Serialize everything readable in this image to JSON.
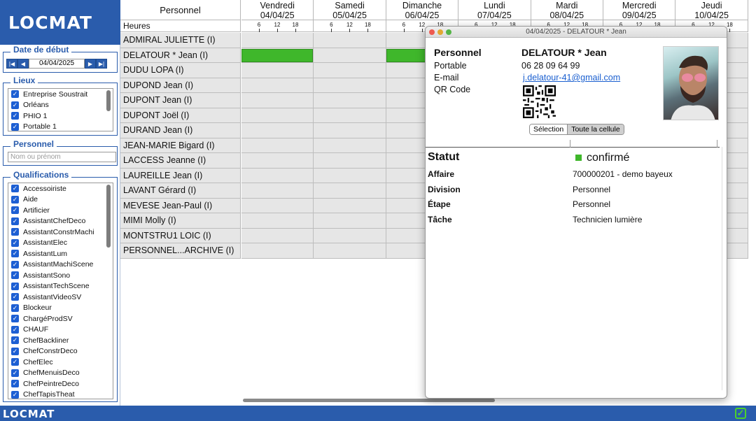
{
  "app": {
    "logo": "LOCMAT",
    "footer_logo": "LOCMAT"
  },
  "left": {
    "date_section": {
      "title": "Date de début",
      "value": "04/04/2025"
    },
    "lieux": {
      "title": "Lieux",
      "items": [
        "Entreprise Soustrait",
        "Orléans",
        "PHIO 1",
        "Portable 1"
      ]
    },
    "personnel": {
      "title": "Personnel",
      "placeholder": "Nom ou prénom"
    },
    "qualifications": {
      "title": "Qualifications",
      "items": [
        "Accessoiriste",
        "Aide",
        "Artificier",
        "AssistantChefDeco",
        "AssistantConstrMachi",
        "AssistantElec",
        "AssistantLum",
        "AssistantMachiScene",
        "AssistantSono",
        "AssistantTechScene",
        "AssistantVideoSV",
        "Blockeur",
        "ChargéProdSV",
        "CHAUF",
        "ChefBackliner",
        "ChefConstrDeco",
        "ChefElec",
        "ChefMenuisDeco",
        "ChefPeintreDeco",
        "ChefTapisTheat"
      ]
    }
  },
  "grid": {
    "person_header": "Personnel",
    "hours_label": "Heures",
    "tick_labels": [
      "6",
      "12",
      "18"
    ],
    "days": [
      {
        "name": "Vendredi",
        "date": "04/04/25"
      },
      {
        "name": "Samedi",
        "date": "05/04/25"
      },
      {
        "name": "Dimanche",
        "date": "06/04/25"
      },
      {
        "name": "Lundi",
        "date": "07/04/25"
      },
      {
        "name": "Mardi",
        "date": "08/04/25"
      },
      {
        "name": "Mercredi",
        "date": "09/04/25"
      },
      {
        "name": "Jeudi",
        "date": "10/04/25"
      }
    ],
    "people": [
      "ADMIRAL JULIETTE (I)",
      "DELATOUR * Jean (I)",
      "DUDU LOPA (I)",
      "DUPOND Jean (I)",
      "DUPONT Jean (I)",
      "DUPONT Joël (I)",
      "DURAND Jean (I)",
      "JEAN-MARIE Bigard (I)",
      "LACCESS Jeanne (I)",
      "LAUREILLE Jean (I)",
      "LAVANT Gérard (I)",
      "MEVESE Jean-Paul (I)",
      "MIMI Molly (I)",
      "MONTSTRU1 LOIC (I)",
      "PERSONNEL...ARCHIVE (I)"
    ],
    "bookings": [
      {
        "person": "DELATOUR * Jean (I)",
        "day": "04/04/25",
        "color": "#3fb72b"
      },
      {
        "person": "DELATOUR * Jean (I)",
        "day": "06/04/25",
        "color": "#3fb72b"
      }
    ]
  },
  "popup": {
    "window_title": "04/04/2025 - DELATOUR * Jean",
    "personnel_label": "Personnel",
    "personnel_value": "DELATOUR * Jean",
    "portable_label": "Portable",
    "portable_value": "06 28 09 64 99",
    "email_label": "E-mail",
    "email_value": "j.delatour-41@gmail.com",
    "qr_label": "QR Code",
    "seg_selection": "Sélection",
    "seg_cell": "Toute la cellule",
    "statut_label": "Statut",
    "statut_value": "confirmé",
    "statut_color": "#3fb72b",
    "rows": [
      {
        "key": "Affaire",
        "value": "700000201 - demo bayeux"
      },
      {
        "key": "Division",
        "value": "Personnel"
      },
      {
        "key": "Étape",
        "value": " Personnel"
      },
      {
        "key": "Tâche",
        "value": "Technicien lumière"
      }
    ]
  },
  "colors": {
    "brand": "#2a5cac",
    "booking": "#3fb72b",
    "row_bg": "#e6e6e6"
  }
}
